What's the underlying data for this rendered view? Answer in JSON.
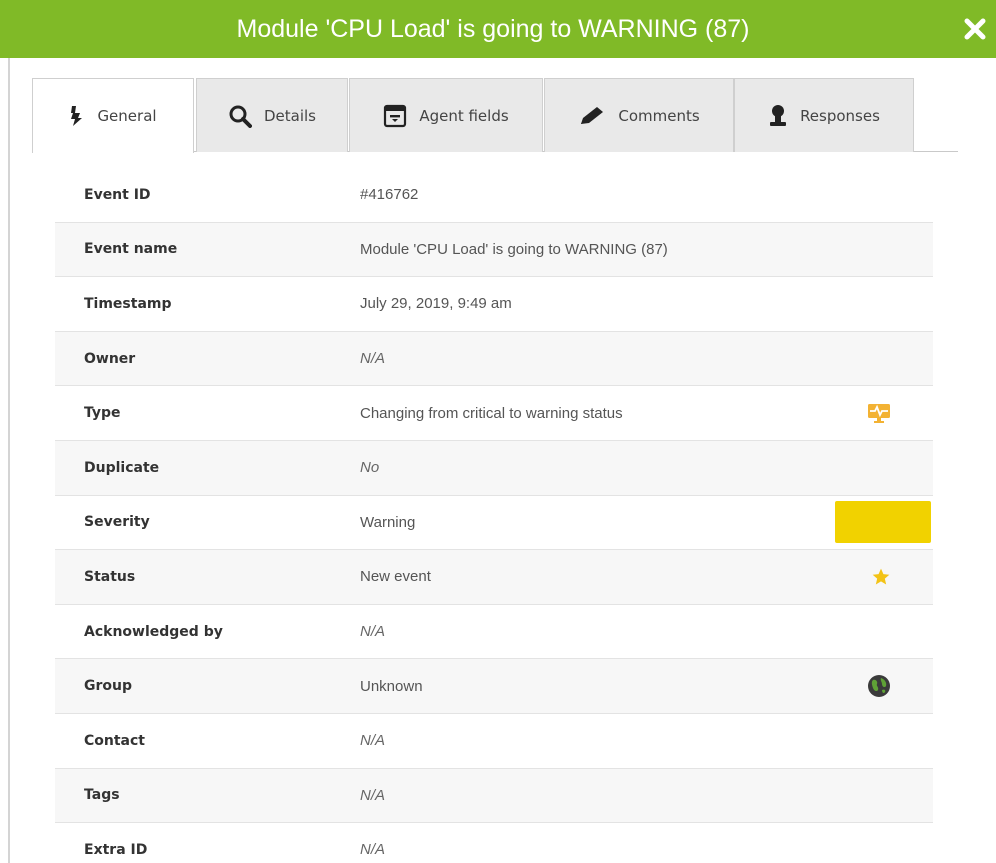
{
  "dialog": {
    "title": "Module 'CPU Load' is going to WARNING (87)",
    "title_bar_color": "#80ba27",
    "close_icon": "close-icon"
  },
  "tabs": [
    {
      "label": "General",
      "icon": "megaphone-icon",
      "active": true
    },
    {
      "label": "Details",
      "icon": "search-icon",
      "active": false
    },
    {
      "label": "Agent fields",
      "icon": "agent-card-icon",
      "active": false
    },
    {
      "label": "Comments",
      "icon": "pencil-icon",
      "active": false
    },
    {
      "label": "Responses",
      "icon": "stamp-icon",
      "active": false
    }
  ],
  "fields": {
    "event_id": {
      "label": "Event ID",
      "value": "#416762"
    },
    "event_name": {
      "label": "Event name",
      "value": "Module 'CPU Load' is going to WARNING (87)"
    },
    "timestamp": {
      "label": "Timestamp",
      "value": "July 29, 2019, 9:49 am"
    },
    "owner": {
      "label": "Owner",
      "value": "N/A"
    },
    "type": {
      "label": "Type",
      "value": "Changing from critical to warning status",
      "icon": "monitor-pulse-icon"
    },
    "duplicate": {
      "label": "Duplicate",
      "value": "No"
    },
    "severity": {
      "label": "Severity",
      "value": "Warning",
      "color": "#f1d200"
    },
    "status": {
      "label": "Status",
      "value": "New event",
      "icon": "star-icon",
      "icon_color": "#f3c316"
    },
    "acknowledged_by": {
      "label": "Acknowledged by",
      "value": "N/A"
    },
    "group": {
      "label": "Group",
      "value": "Unknown",
      "icon": "globe-icon"
    },
    "contact": {
      "label": "Contact",
      "value": "N/A"
    },
    "tags": {
      "label": "Tags",
      "value": "N/A"
    },
    "extra_id": {
      "label": "Extra ID",
      "value": "N/A"
    }
  }
}
